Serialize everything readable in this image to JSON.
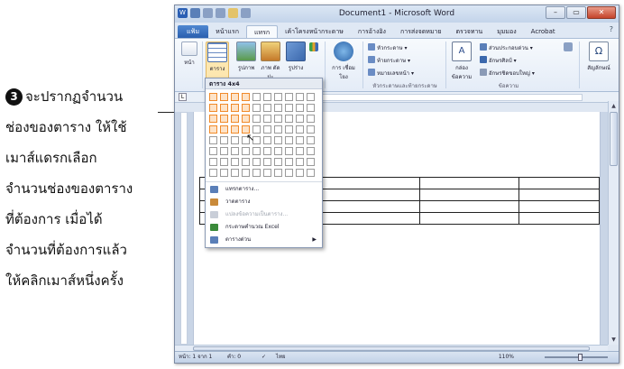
{
  "annotation": {
    "number": "3",
    "lines": [
      "จะปรากฏจำนวน",
      "ช่องของตาราง ให้ใช้",
      "เมาส์แดรกเลือก",
      "จำนวนช่องของตาราง",
      "ที่ต้องการ เมื่อได้",
      "จำนวนที่ต้องการแล้ว",
      "ให้คลิกเมาส์หนึ่งครั้ง"
    ]
  },
  "window": {
    "title": "Document1 - Microsoft Word",
    "minimize": "–",
    "restore": "▭",
    "close": "✕"
  },
  "tabs": [
    "แฟ้ม",
    "หน้าแรก",
    "แทรก",
    "เค้าโครงหน้ากระดาษ",
    "การอ้างอิง",
    "การส่งจดหมาย",
    "ตรวจทาน",
    "มุมมอง",
    "Acrobat"
  ],
  "ribbon": {
    "page": "หน้า",
    "table": "ตาราง",
    "picture": "รูปภาพ",
    "clipart": "ภาพ ตัดปะ",
    "shapes": "รูปร่าง",
    "links": "การ เชื่อมโยง",
    "header": "หัวกระดาษ",
    "footer": "ท้ายกระดาษ",
    "page_number": "หมายเลขหน้า",
    "header_footer_group": "หัวกระดาษและท้ายกระดาษ",
    "textbox": "กล่อง ข้อความ",
    "quick_parts": "ส่วนประกอบด่วน",
    "wordart": "อักษรศิลป์",
    "dropcap": "อักษรชิดขอบใหญ่",
    "text_group": "ข้อความ",
    "symbols": "สัญลักษณ์"
  },
  "dropdown": {
    "header": "ตาราง 4x4",
    "cols": 10,
    "rows": 8,
    "selected_cols": 4,
    "selected_rows": 4,
    "items": [
      {
        "label": "แทรกตาราง...",
        "disabled": false,
        "submenu": false
      },
      {
        "label": "วาดตาราง",
        "disabled": false,
        "submenu": false
      },
      {
        "label": "แปลงข้อความเป็นตาราง...",
        "disabled": true,
        "submenu": false
      },
      {
        "label": "กระดาษคำนวณ Excel",
        "disabled": false,
        "submenu": false
      },
      {
        "label": "ตารางด่วน",
        "disabled": false,
        "submenu": true
      }
    ]
  },
  "document": {
    "table_rows": 4,
    "table_cols": 4
  },
  "status": {
    "page": "หน้า: 1 จาก 1",
    "words": "คำ: 0",
    "language": "ไทย",
    "zoom": "110%"
  }
}
